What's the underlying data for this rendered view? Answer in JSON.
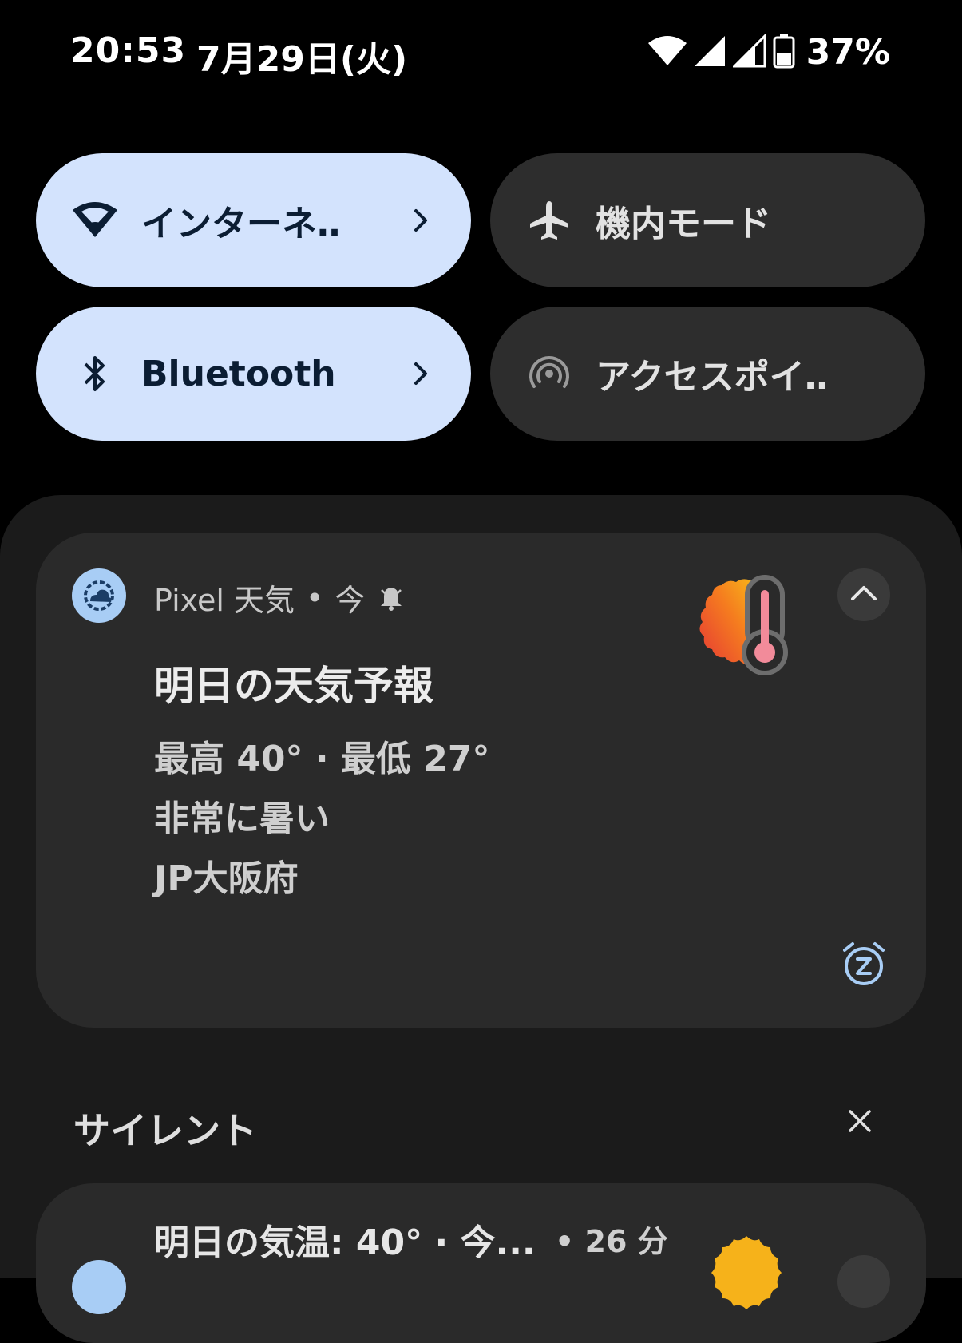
{
  "status_bar": {
    "time": "20:53",
    "date": "7月29日(火)",
    "battery_percent": "37%",
    "icons": [
      "wifi-icon",
      "signal-icon",
      "signal-icon",
      "battery-icon"
    ]
  },
  "tiles": [
    {
      "label": "インターネ‥",
      "icon": "wifi-icon",
      "active": true,
      "has_chevron": true
    },
    {
      "label": "機内モード",
      "icon": "airplane-icon",
      "active": false,
      "has_chevron": false
    },
    {
      "label": "Bluetooth",
      "icon": "bluetooth-icon",
      "active": true,
      "has_chevron": true
    },
    {
      "label": "アクセスポイ‥",
      "icon": "hotspot-icon",
      "active": false,
      "has_chevron": false
    }
  ],
  "notification": {
    "app_name": "Pixel 天気",
    "separator": "•",
    "time": "今",
    "title": "明日の天気予報",
    "lines": [
      "最高 40° · 最低 27°",
      "非常に暑い",
      "JP大阪府"
    ],
    "icons": {
      "app": "pixel-weather-icon",
      "bell": "bell-icon",
      "art": "hot-weather-thermometer-icon",
      "expand": "chevron-up-icon",
      "snooze": "snooze-icon"
    }
  },
  "silent_section": {
    "header": "サイレント",
    "close_icon": "close-icon"
  },
  "notification2": {
    "title": "明日の気温: 40° · 今...",
    "time": "• 26 分",
    "art": "sun-icon"
  },
  "colors": {
    "background": "#000000",
    "tile_active": "#d3e3fd",
    "tile_inactive": "#2d2d2d",
    "card": "#2a2a2a",
    "accent_blue": "#a8cdf5"
  }
}
